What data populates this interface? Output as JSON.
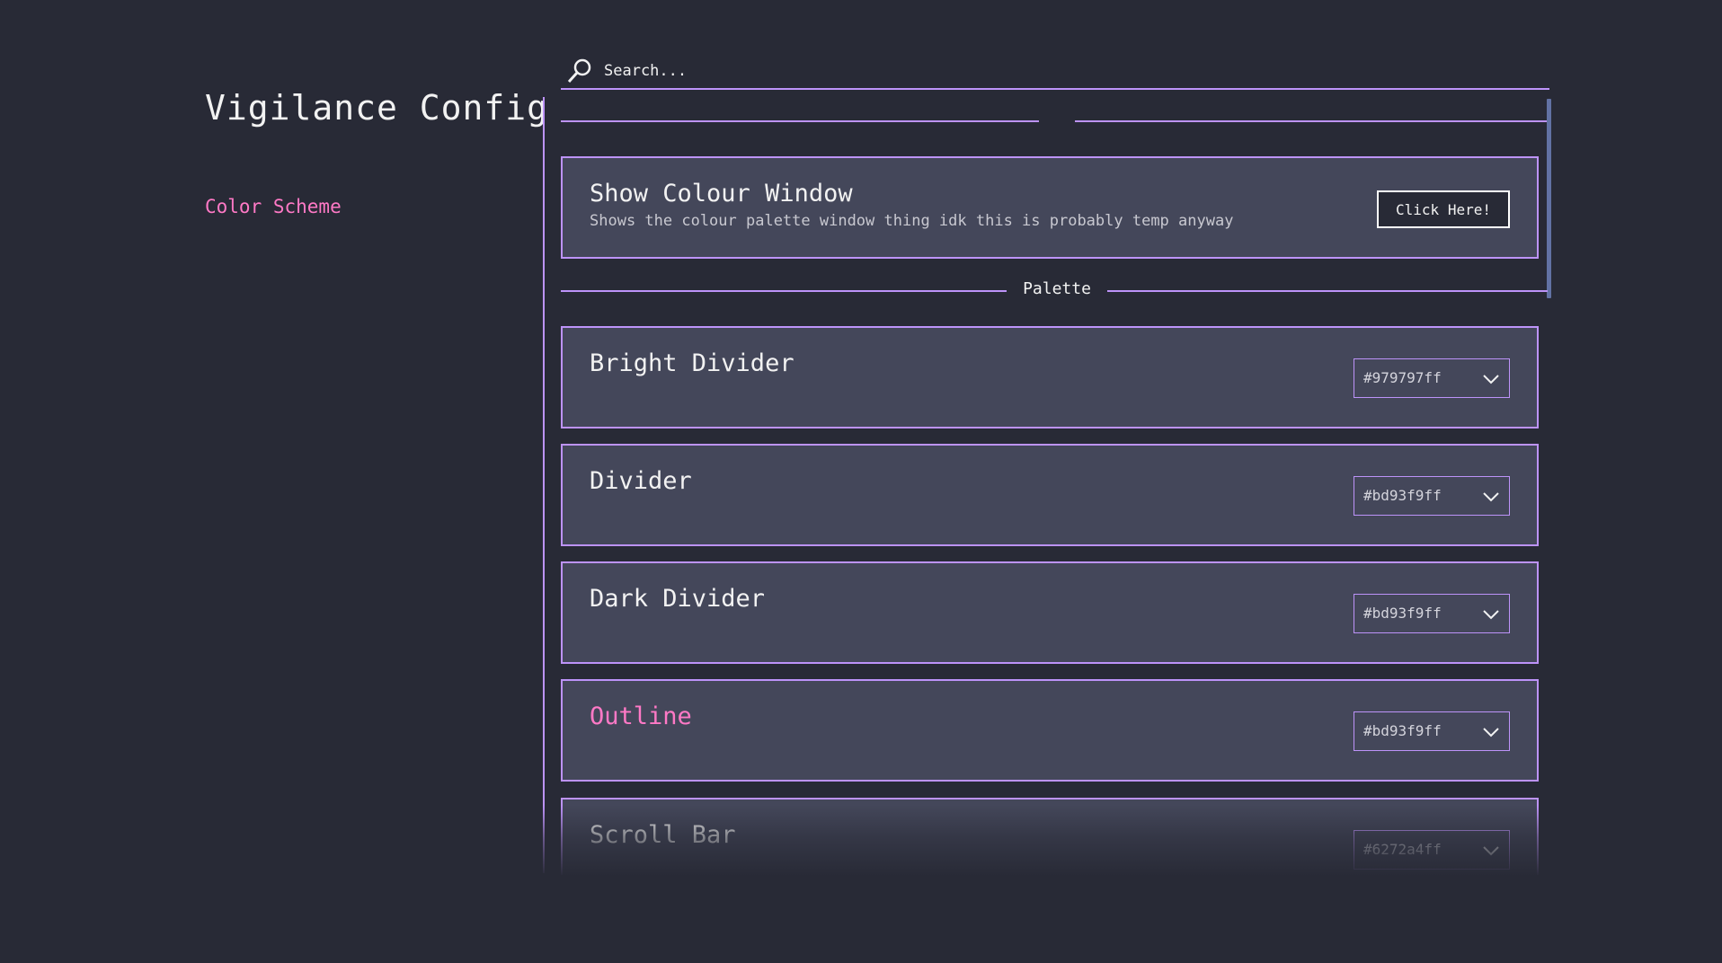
{
  "app": {
    "title": "Vigilance Config"
  },
  "sidebar": {
    "categories": [
      {
        "label": "Color Scheme",
        "selected": true
      }
    ]
  },
  "search": {
    "placeholder": "Search..."
  },
  "colors": {
    "background": "#282a36",
    "card": "#44475a",
    "accent_purple": "#bd93f9",
    "accent_pink": "#ff79c6",
    "scrollbar": "#6272a4"
  },
  "settings": {
    "show_colour_window": {
      "title": "Show Colour Window",
      "description": "Shows the colour palette window thing idk this is probably temp anyway",
      "button_label": "Click Here!"
    },
    "palette_header": "Palette",
    "palette": [
      {
        "title": "Bright Divider",
        "value": "#979797ff",
        "hovered": false
      },
      {
        "title": "Divider",
        "value": "#bd93f9ff",
        "hovered": false
      },
      {
        "title": "Dark Divider",
        "value": "#bd93f9ff",
        "hovered": false
      },
      {
        "title": "Outline",
        "value": "#bd93f9ff",
        "hovered": true
      },
      {
        "title": "Scroll Bar",
        "value": "#6272a4ff",
        "hovered": false
      }
    ]
  },
  "icons": {
    "search": "search-icon",
    "dropdown": "chevron-down-icon"
  }
}
